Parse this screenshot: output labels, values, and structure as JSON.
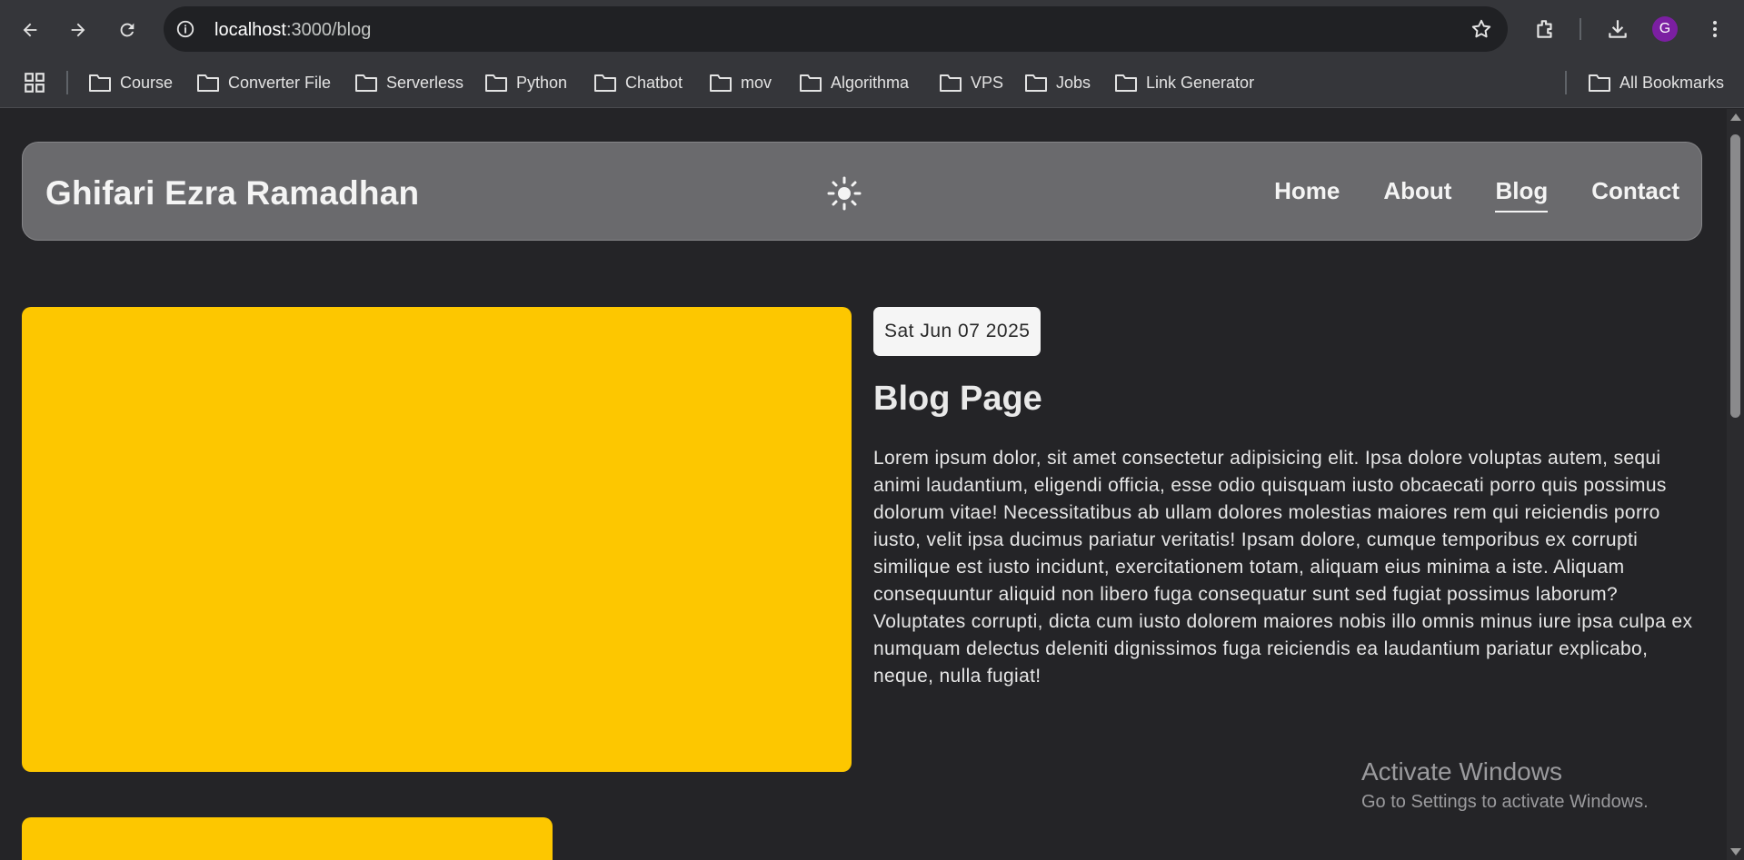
{
  "browser": {
    "url_host": "localhost",
    "url_path": ":3000/blog",
    "avatar_initial": "G",
    "bookmarks": [
      "Course",
      "Converter File",
      "Serverless",
      "Python",
      "Chatbot",
      "mov",
      "Algorithma",
      "VPS",
      "Jobs",
      "Link Generator"
    ],
    "all_bookmarks_label": "All Bookmarks"
  },
  "site": {
    "brand": "Ghifari Ezra Ramadhan",
    "nav": [
      "Home",
      "About",
      "Blog",
      "Contact"
    ],
    "active_nav": "Blog"
  },
  "post": {
    "date": "Sat Jun 07 2025",
    "title": "Blog Page",
    "body": "Lorem ipsum dolor, sit amet consectetur adipisicing elit. Ipsa dolore voluptas autem, sequi animi laudantium, eligendi officia, esse odio quisquam iusto obcaecati porro quis possimus dolorum vitae! Necessitatibus ab ullam dolores molestias maiores rem qui reiciendis porro iusto, velit ipsa ducimus pariatur veritatis! Ipsam dolore, cumque temporibus ex corrupti similique est iusto incidunt, exercitationem totam, aliquam eius minima a iste. Aliquam consequuntur aliquid non libero fuga consequatur sunt sed fugiat possimus laborum? Voluptates corrupti, dicta cum iusto dolorem maiores nobis illo omnis minus iure ipsa culpa ex numquam delectus deleniti dignissimos fuga reiciendis ea laudantium pariatur explicabo, neque, nulla fugiat!"
  },
  "watermark": {
    "line1": "Activate Windows",
    "line2": "Go to Settings to activate Windows."
  },
  "colors": {
    "page_bg": "#242427",
    "navbar_bg": "#6a6a6d",
    "image_placeholder": "#fdc700",
    "avatar": "#7b1fa2"
  }
}
